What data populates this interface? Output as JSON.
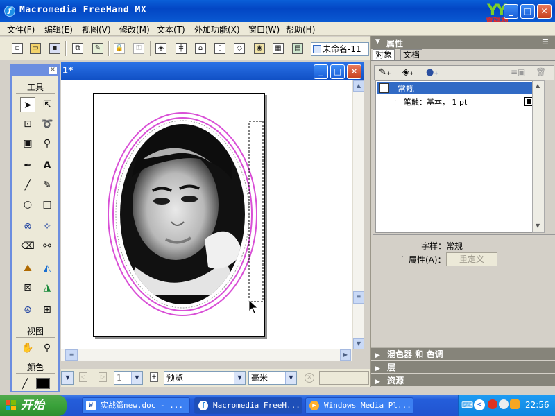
{
  "window": {
    "title": "Macromedia FreeHand MX",
    "logo_text": "YY",
    "logo_cn": "育碟苑"
  },
  "menu": [
    "文件(F)",
    "编辑(E)",
    "视图(V)",
    "修改(M)",
    "文本(T)",
    "外加功能(X)",
    "窗口(W)",
    "帮助(H)"
  ],
  "toolbar": {
    "doc_combo": "未命名-11"
  },
  "document": {
    "title_fragment": "1*"
  },
  "tools_panel": {
    "section_tools": "工具",
    "section_view": "视图",
    "section_color": "颜色"
  },
  "status": {
    "page_number": "1",
    "view_mode": "预览",
    "unit": "毫米"
  },
  "properties_panel": {
    "title": "属性",
    "tab_object": "对象",
    "tab_document": "文档",
    "item_selected": "常规",
    "item_stroke": "笔触：基本， 1 pt",
    "style_label": "字样：常规",
    "attr_label": "属性(A)：",
    "redefine_button": "重定义",
    "section_mixer": "混色器 和 色调",
    "section_layers": "层",
    "section_assets": "资源"
  },
  "taskbar": {
    "start_label": "开始",
    "tasks": [
      "实战篇new.doc - ...",
      "Macromedia FreeH...",
      "Windows Media Pl..."
    ],
    "clock": "22:56"
  },
  "colors": {
    "xp_blue": "#0a5fd8",
    "start_green": "#39a23a",
    "selection_blue": "#316ac5",
    "ellipse_magenta": "#d94fd6"
  }
}
